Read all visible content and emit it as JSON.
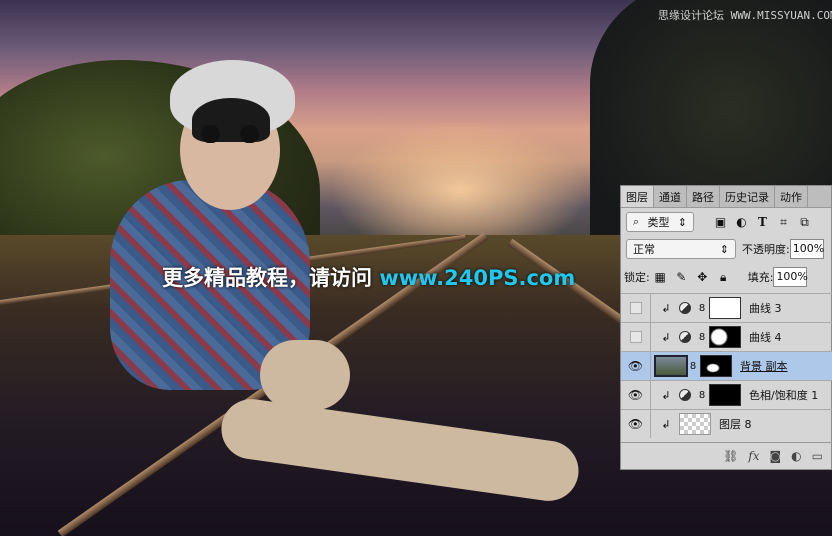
{
  "watermark": {
    "text": "更多精品教程，请访问 ",
    "url": "www.240PS.com"
  },
  "site_watermark": "思缘设计论坛 WWW.MISSYUAN.COM",
  "panel": {
    "tabs": [
      "图层",
      "通道",
      "路径",
      "历史记录",
      "动作"
    ],
    "filter": {
      "label": "类型",
      "icons": [
        "image-filter-icon",
        "adjustment-filter-icon",
        "type-filter-icon",
        "shape-filter-icon",
        "smart-object-filter-icon"
      ]
    },
    "blend_mode": "正常",
    "opacity_label": "不透明度:",
    "opacity": "100%",
    "lock_label": "锁定:",
    "fill_label": "填充:",
    "fill": "100%",
    "layers": [
      {
        "name": "曲线 3",
        "visible": false
      },
      {
        "name": "曲线 4",
        "visible": false
      },
      {
        "name": "背景 副本",
        "visible": true,
        "selected": true
      },
      {
        "name": "色相/饱和度 1",
        "visible": true
      },
      {
        "name": "图层 8",
        "visible": true
      }
    ],
    "bottom_icons": [
      "link-icon",
      "fx-icon",
      "mask-icon",
      "adjustment-icon",
      "folder-icon"
    ]
  }
}
